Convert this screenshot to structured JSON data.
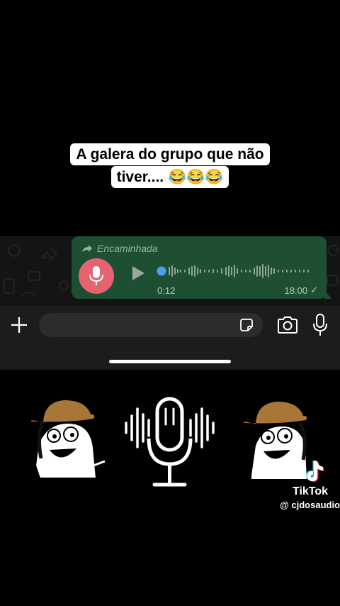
{
  "caption": {
    "line1": "A galera do grupo que não",
    "line2": "tiver.... 😂😂😂"
  },
  "message": {
    "forwarded_label": "Encaminhada",
    "duration": "0:12",
    "time": "18:00",
    "status": "✓"
  },
  "watermark": {
    "brand": "TikTok",
    "handle": "@ cjdosaudio"
  },
  "colors": {
    "bubble": "#1f4f33",
    "mic_circle": "#e5636e",
    "progress_dot": "#4a9ff0"
  }
}
